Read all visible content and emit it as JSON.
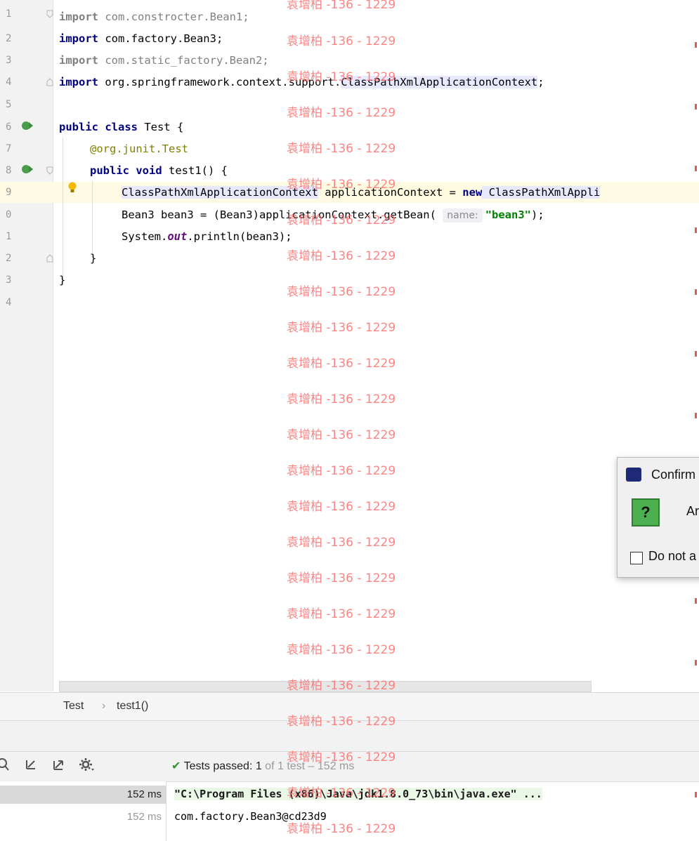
{
  "editor": {
    "line_numbers": [
      "1",
      "2",
      "3",
      "4",
      "5",
      "6",
      "7",
      "8",
      "9",
      "0",
      "1",
      "2",
      "3",
      "4"
    ],
    "imports": [
      {
        "kw": "import",
        "text": " com.constrocter.Bean1;"
      },
      {
        "kw": "import",
        "text": " com.factory.Bean3;"
      },
      {
        "kw": "import",
        "text": " com.static_factory.Bean2;"
      },
      {
        "kw": "import",
        "text": " org.springframework.context.support.",
        "hl": "ClassPathXmlApplicationContext",
        "tail": ";"
      }
    ],
    "class_decl": {
      "kw": "public class",
      "text": " Test {"
    },
    "annotation": {
      "at": "@org.junit.",
      "name": "Test"
    },
    "method_decl": {
      "kw": "public void",
      "text": " test1() {"
    },
    "line9": {
      "type": "ClassPathXmlApplicationContext",
      "var": " applicationContext = ",
      "kw": "new",
      "tail": " ClassPathXmlAppli"
    },
    "line10": {
      "pre": "Bean3 bean3 = (Bean3)applicationContext.getBean( ",
      "hint": "name:",
      "str": "\"bean3\"",
      "post": ");"
    },
    "line11": {
      "pre": "System.",
      "static": "out",
      "post": ".println(bean3);"
    },
    "close_method": "}",
    "close_class": "}"
  },
  "breadcrumb": {
    "class": "Test",
    "sep": "›",
    "method": "test1()"
  },
  "test_status": {
    "label": "Tests passed: 1",
    "meta": " of 1 test – 152 ms"
  },
  "tree": {
    "row1_time": "152 ms",
    "row2_time": "152 ms"
  },
  "console": {
    "cmd": "\"C:\\Program Files (x86)\\Java\\jdk1.8.0_73\\bin\\java.exe\" ...",
    "output": "com.factory.Bean3@cd23d9"
  },
  "dialog": {
    "title": "Confirm",
    "message": "Ar",
    "checkbox_label": "Do not a",
    "icon": "question-icon"
  },
  "watermark": "袁增柏 -136 - 1229",
  "colors": {
    "keyword": "#000080",
    "string": "#008000",
    "annotation": "#808000",
    "pass": "#3a8f3a"
  }
}
